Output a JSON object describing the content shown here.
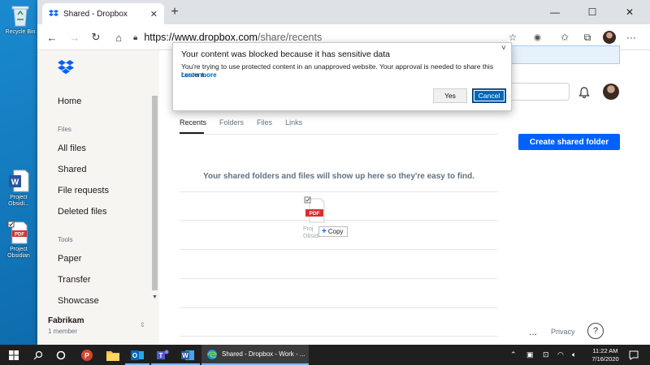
{
  "desktop": {
    "icons": [
      {
        "label": "Recycle Bin"
      },
      {
        "label": "Project Obsidi..."
      },
      {
        "label": "Project Obsidian"
      }
    ]
  },
  "browser": {
    "tab_title": "Shared - Dropbox",
    "url_host": "https://www.dropbox.com",
    "url_path": "/share/recents"
  },
  "sidebar": {
    "home": "Home",
    "files_section": "Files",
    "all_files": "All files",
    "shared": "Shared",
    "file_requests": "File requests",
    "deleted_files": "Deleted files",
    "tools_section": "Tools",
    "paper": "Paper",
    "transfer": "Transfer",
    "showcase": "Showcase",
    "team_name": "Fabrikam",
    "team_members": "1 member"
  },
  "main": {
    "tabs": [
      {
        "label": "Recents",
        "active": true
      },
      {
        "label": "Folders",
        "active": false
      },
      {
        "label": "Files",
        "active": false
      },
      {
        "label": "Links",
        "active": false
      }
    ],
    "create_button": "Create shared folder",
    "empty_message": "Your shared folders and files will show up here so they're easy to find.",
    "drag_file_badge": "PDF",
    "drag_file_name_1": "Proj",
    "drag_file_name_2": "Obsidi",
    "copy_tooltip": "Copy",
    "footer_more": "...",
    "footer_privacy": "Privacy",
    "help_symbol": "?"
  },
  "dialog": {
    "title": "Your content was blocked because it has sensitive data",
    "body": "You're trying to use protected content in an unapproved website. Your approval is needed to share this content.",
    "link": "Learn more",
    "yes": "Yes",
    "cancel": "Cancel"
  },
  "taskbar": {
    "active_window": "Shared - Dropbox - Work - ...",
    "time": "11:22 AM",
    "date": "7/16/2020"
  },
  "colors": {
    "dropbox_blue": "#0061fe",
    "windows_blue": "#0067b8"
  }
}
